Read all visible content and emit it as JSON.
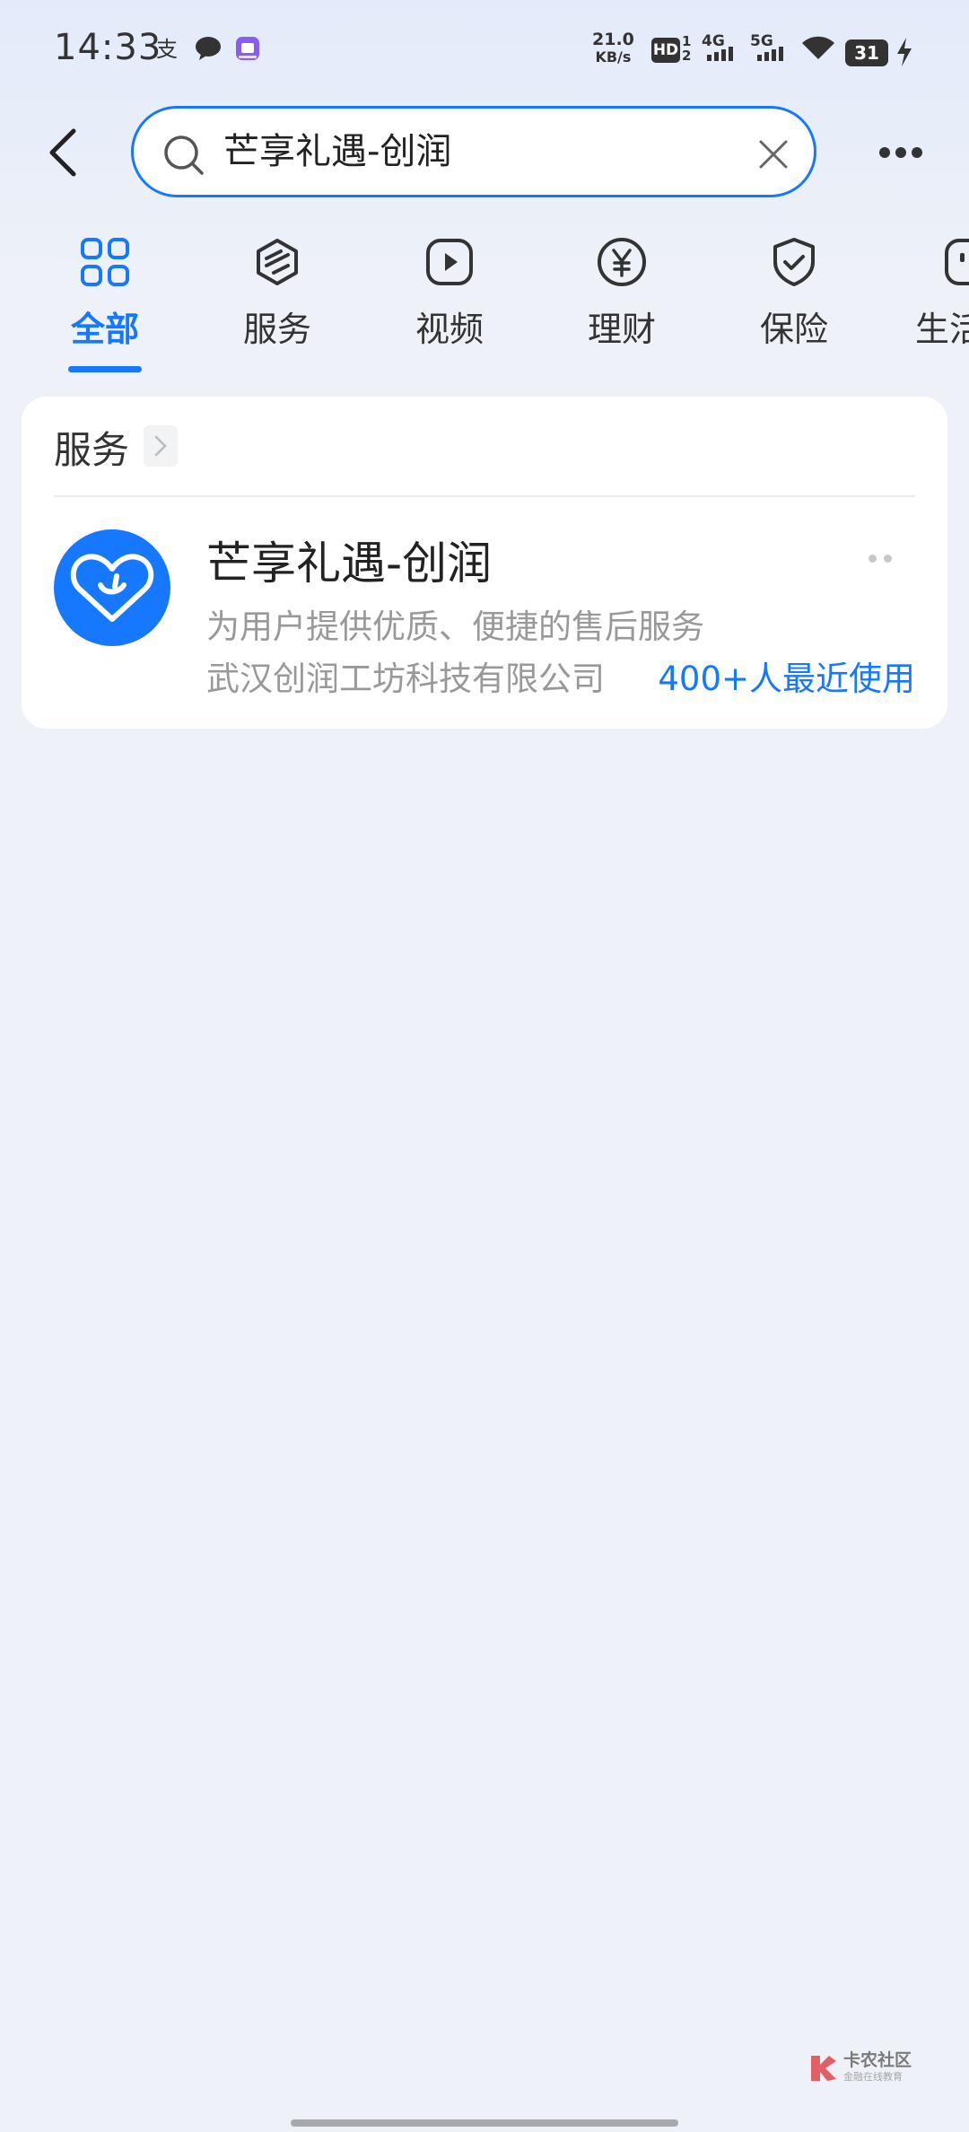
{
  "status_bar": {
    "time": "14:33",
    "net_speed": "21.0",
    "net_speed_unit": "KB/s",
    "hd": "HD",
    "hd_sub": "1 2",
    "net1": "4G",
    "net2": "5G",
    "battery": "31",
    "icons": [
      "alipay-icon",
      "message-icon",
      "app-badge-icon",
      "wifi-icon",
      "charging-icon"
    ]
  },
  "search": {
    "query": "芒享礼遇-创润"
  },
  "tabs": [
    {
      "label": "全部",
      "icon": "grid-icon",
      "active": true
    },
    {
      "label": "服务",
      "icon": "service-icon",
      "active": false
    },
    {
      "label": "视频",
      "icon": "play-icon",
      "active": false
    },
    {
      "label": "理财",
      "icon": "yuan-icon",
      "active": false
    },
    {
      "label": "保险",
      "icon": "shield-icon",
      "active": false
    },
    {
      "label": "生活",
      "icon": "life-icon",
      "active": false
    }
  ],
  "section": {
    "title": "服务",
    "result": {
      "name": "芒享礼遇-创润",
      "description": "为用户提供优质、便捷的售后服务",
      "company": "武汉创润工坊科技有限公司",
      "usage": "400+人最近使用"
    }
  },
  "watermark": {
    "title": "卡农社区",
    "subtitle": "金融在线教育"
  },
  "colors": {
    "accent": "#1677ff",
    "background": "#eef2f8"
  }
}
